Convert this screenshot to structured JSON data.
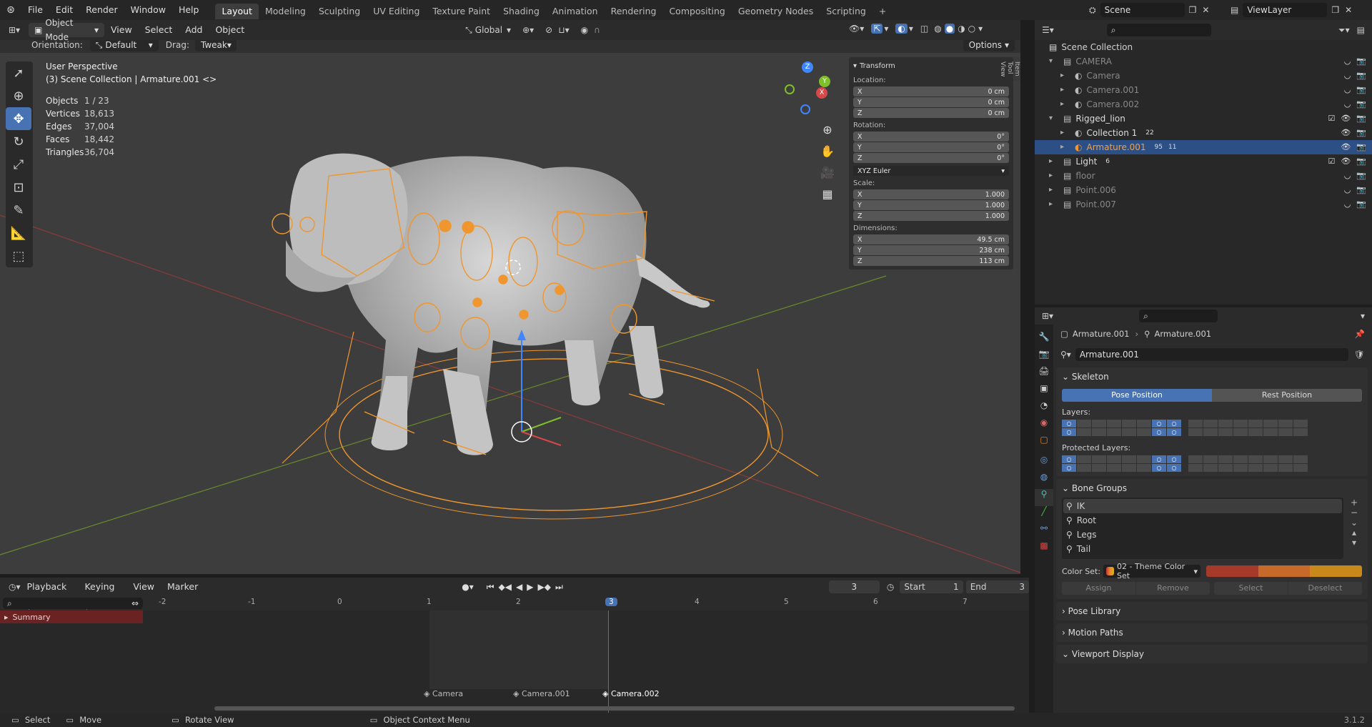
{
  "topbar": {
    "menus": [
      "File",
      "Edit",
      "Render",
      "Window",
      "Help"
    ],
    "workspaces": [
      "Layout",
      "Modeling",
      "Sculpting",
      "UV Editing",
      "Texture Paint",
      "Shading",
      "Animation",
      "Rendering",
      "Compositing",
      "Geometry Nodes",
      "Scripting"
    ],
    "active_workspace": "Layout",
    "add_tab": "+",
    "scene": "Scene",
    "view_layer": "ViewLayer"
  },
  "viewport_header": {
    "mode": "Object Mode",
    "menus": [
      "View",
      "Select",
      "Add",
      "Object"
    ],
    "transform_orientation": "Global"
  },
  "tool_settings": {
    "orientation_label": "Orientation:",
    "orientation_value": "Default",
    "drag_label": "Drag:",
    "drag_value": "Tweak",
    "options": "Options"
  },
  "overlay_text": {
    "view_name": "User Perspective",
    "collection_line": "(3) Scene Collection | Armature.001 <>"
  },
  "stats": [
    {
      "label": "Objects",
      "value": "1 / 23"
    },
    {
      "label": "Vertices",
      "value": "18,613"
    },
    {
      "label": "Edges",
      "value": "37,004"
    },
    {
      "label": "Faces",
      "value": "18,442"
    },
    {
      "label": "Triangles",
      "value": "36,704"
    }
  ],
  "n_panel": {
    "header": "Transform",
    "location_label": "Location:",
    "location": [
      {
        "axis": "X",
        "value": "0 cm"
      },
      {
        "axis": "Y",
        "value": "0 cm"
      },
      {
        "axis": "Z",
        "value": "0 cm"
      }
    ],
    "rotation_label": "Rotation:",
    "rotation": [
      {
        "axis": "X",
        "value": "0°"
      },
      {
        "axis": "Y",
        "value": "0°"
      },
      {
        "axis": "Z",
        "value": "0°"
      }
    ],
    "rotation_mode": "XYZ Euler",
    "scale_label": "Scale:",
    "scale": [
      {
        "axis": "X",
        "value": "1.000"
      },
      {
        "axis": "Y",
        "value": "1.000"
      },
      {
        "axis": "Z",
        "value": "1.000"
      }
    ],
    "dimensions_label": "Dimensions:",
    "dimensions": [
      {
        "axis": "X",
        "value": "49.5 cm"
      },
      {
        "axis": "Y",
        "value": "238 cm"
      },
      {
        "axis": "Z",
        "value": "113 cm"
      }
    ],
    "tabs": [
      "Item",
      "Tool",
      "View"
    ]
  },
  "gizmo": {
    "x": "X",
    "y": "Y",
    "z": "Z"
  },
  "outliner": {
    "search_placeholder": "",
    "root": "Scene Collection",
    "rows": [
      {
        "label": "CAMERA",
        "level": 1,
        "dim": true
      },
      {
        "label": "Camera",
        "level": 2,
        "dim": true
      },
      {
        "label": "Camera.001",
        "level": 2,
        "dim": true
      },
      {
        "label": "Camera.002",
        "level": 2,
        "dim": true
      },
      {
        "label": "Rigged_lion",
        "level": 1,
        "dim": false
      },
      {
        "label": "Collection 1",
        "level": 2,
        "dim": false,
        "badge": "22"
      },
      {
        "label": "Armature.001",
        "level": 2,
        "dim": false,
        "selected": true,
        "badge": "95",
        "badge2": "11"
      },
      {
        "label": "Light",
        "level": 1,
        "dim": false,
        "badge": "6"
      },
      {
        "label": "floor",
        "level": 1,
        "dim": true
      },
      {
        "label": "Point.006",
        "level": 1,
        "dim": true
      },
      {
        "label": "Point.007",
        "level": 1,
        "dim": true
      }
    ]
  },
  "properties": {
    "breadcrumb_object": "Armature.001",
    "breadcrumb_data": "Armature.001",
    "datablock": "Armature.001",
    "skeleton": {
      "title": "Skeleton",
      "pose_position": "Pose Position",
      "rest_position": "Rest Position",
      "layers_label": "Layers:",
      "protected_label": "Protected Layers:"
    },
    "bone_groups": {
      "title": "Bone Groups",
      "items": [
        "IK",
        "Root",
        "Legs",
        "Tail"
      ],
      "color_set_label": "Color Set:",
      "color_set_value": "02 - Theme Color Set",
      "assign": "Assign",
      "remove": "Remove",
      "select": "Select",
      "deselect": "Deselect"
    },
    "collapsed_sections": [
      "Pose Library",
      "Motion Paths"
    ],
    "viewport_display": "Viewport Display"
  },
  "timeline": {
    "menus": [
      "Playback",
      "Keying",
      "View",
      "Marker"
    ],
    "current_frame": "3",
    "start_label": "Start",
    "start": "1",
    "end_label": "End",
    "end": "3",
    "ruler": [
      "-2",
      "-1",
      "0",
      "1",
      "2",
      "3",
      "4",
      "5",
      "6",
      "7"
    ],
    "summary": "Summary",
    "markers": [
      "Camera",
      "Camera.001",
      "Camera.002"
    ]
  },
  "statusbar": {
    "select": "Select",
    "move": "Move",
    "rotate": "Rotate View",
    "context": "Object Context Menu",
    "version": "3.1.2"
  },
  "colors": {
    "accent": "#4772b3",
    "selection_orange": "#f0962e",
    "outliner_selected": "#2c4f85",
    "bone_red": "#a53a2a",
    "bone_orange": "#c66a2a",
    "bone_gold": "#c9891a"
  }
}
